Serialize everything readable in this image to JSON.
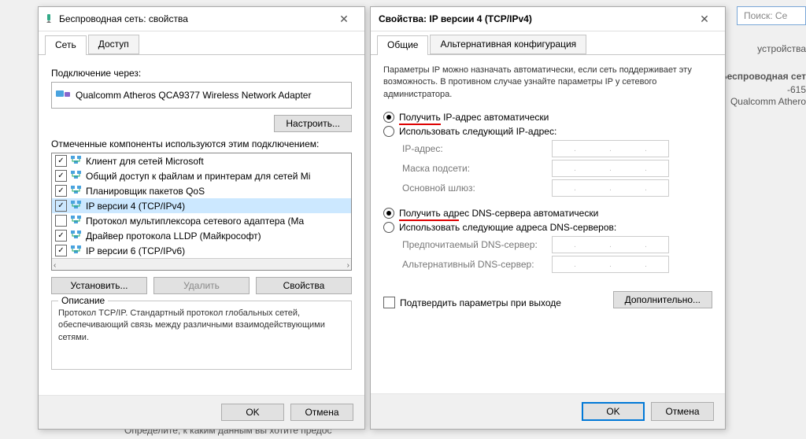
{
  "search_placeholder": "Поиск: Се",
  "bg_devices": "устройства",
  "bg_wifi": "Беспроводная сет",
  "bg_router": "-615",
  "bg_adapter": "Qualcomm Athero",
  "bg_hint": "Определите, к каким данным вы хотите предос",
  "left": {
    "title": "Беспроводная сеть: свойства",
    "tabs": {
      "net": "Сеть",
      "access": "Доступ"
    },
    "connect_via": "Подключение через:",
    "adapter": "Qualcomm Atheros QCA9377 Wireless Network Adapter",
    "configure": "Настроить...",
    "components_label": "Отмеченные компоненты используются этим подключением:",
    "components": [
      {
        "checked": true,
        "label": "Клиент для сетей Microsoft"
      },
      {
        "checked": true,
        "label": "Общий доступ к файлам и принтерам для сетей Mi"
      },
      {
        "checked": true,
        "label": "Планировщик пакетов QoS"
      },
      {
        "checked": true,
        "label": "IP версии 4 (TCP/IPv4)",
        "selected": true
      },
      {
        "checked": false,
        "label": "Протокол мультиплексора сетевого адаптера (Ma"
      },
      {
        "checked": true,
        "label": "Драйвер протокола LLDP (Майкрософт)"
      },
      {
        "checked": true,
        "label": "IP версии 6 (TCP/IPv6)"
      }
    ],
    "install": "Установить...",
    "remove": "Удалить",
    "properties": "Свойства",
    "desc_legend": "Описание",
    "desc": "Протокол TCP/IP. Стандартный протокол глобальных сетей, обеспечивающий связь между различными взаимодействующими сетями.",
    "ok": "OK",
    "cancel": "Отмена"
  },
  "right": {
    "title": "Свойства: IP версии 4 (TCP/IPv4)",
    "tabs": {
      "general": "Общие",
      "alt": "Альтернативная конфигурация"
    },
    "intro": "Параметры IP можно назначать автоматически, если сеть поддерживает эту возможность. В противном случае узнайте параметры IP у сетевого администратора.",
    "ip_auto": "Получить IP-адрес автоматически",
    "ip_auto_u": "Получить",
    "ip_auto_rest": " IP-адрес автоматически",
    "ip_manual": "Использовать следующий IP-адрес:",
    "ip_addr": "IP-адрес:",
    "mask": "Маска подсети:",
    "gateway": "Основной шлюз:",
    "dns_auto_u": "Получить адр",
    "dns_auto_rest": "ес DNS-сервера автоматически",
    "dns_manual": "Использовать следующие адреса DNS-серверов:",
    "dns_pref": "Предпочитаемый DNS-сервер:",
    "dns_alt": "Альтернативный DNS-сервер:",
    "confirm_exit": "Подтвердить параметры при выходе",
    "advanced": "Дополнительно...",
    "ok": "OK",
    "cancel": "Отмена"
  }
}
